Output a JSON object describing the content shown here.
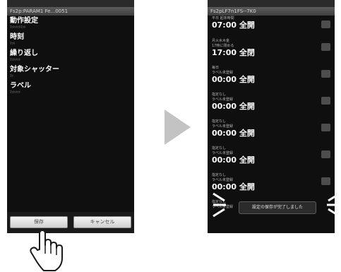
{
  "left_screen": {
    "title": "Fs2p:PARAM1 Fe...0051",
    "settings": [
      {
        "title": "動作設定",
        "subtitle": "ﾏｯﾄﾒｯﾄﾏｯﾄ"
      },
      {
        "title": "時刻",
        "subtitle": "ﾏｯﾄ"
      },
      {
        "title": "繰り返し",
        "subtitle": "ﾏｯﾄﾒｯﾄ"
      },
      {
        "title": "対象シャッター",
        "subtitle": "ﾏｯ"
      },
      {
        "title": "ラベル",
        "subtitle": "ﾏｯﾄﾒｯﾄ"
      }
    ],
    "buttons": {
      "save": "保存",
      "cancel": "キャンセル"
    }
  },
  "right_screen": {
    "title": "Fs2pLF7n1FS--7K0",
    "rows": [
      {
        "header": "平日 起床時間",
        "time": "07:00 全開"
      },
      {
        "header": "月火水木金",
        "header2": "17時に閉める",
        "time": "17:00 全閉"
      },
      {
        "header": "毎日",
        "header2": "ラベル未登録",
        "time": "00:00 全開"
      },
      {
        "header": "指定なし",
        "header2": "ラベル未登録",
        "time": "00:00 全開"
      },
      {
        "header": "指定なし",
        "header2": "ラベル未登録",
        "time": "00:00 全開"
      },
      {
        "header": "指定なし",
        "header2": "ラベル未登録",
        "time": "00:00 全開"
      },
      {
        "header": "指定なし",
        "header2": "ラベル未登録",
        "time": "00:00 全開"
      },
      {
        "header": "指定なし",
        "header2": "ラベル未登録",
        "time": ""
      }
    ],
    "toast": "設定の保存が完了しました"
  },
  "colors": {
    "screen_bg": "#0f0f0f",
    "arrow": "#c3c3c3"
  }
}
